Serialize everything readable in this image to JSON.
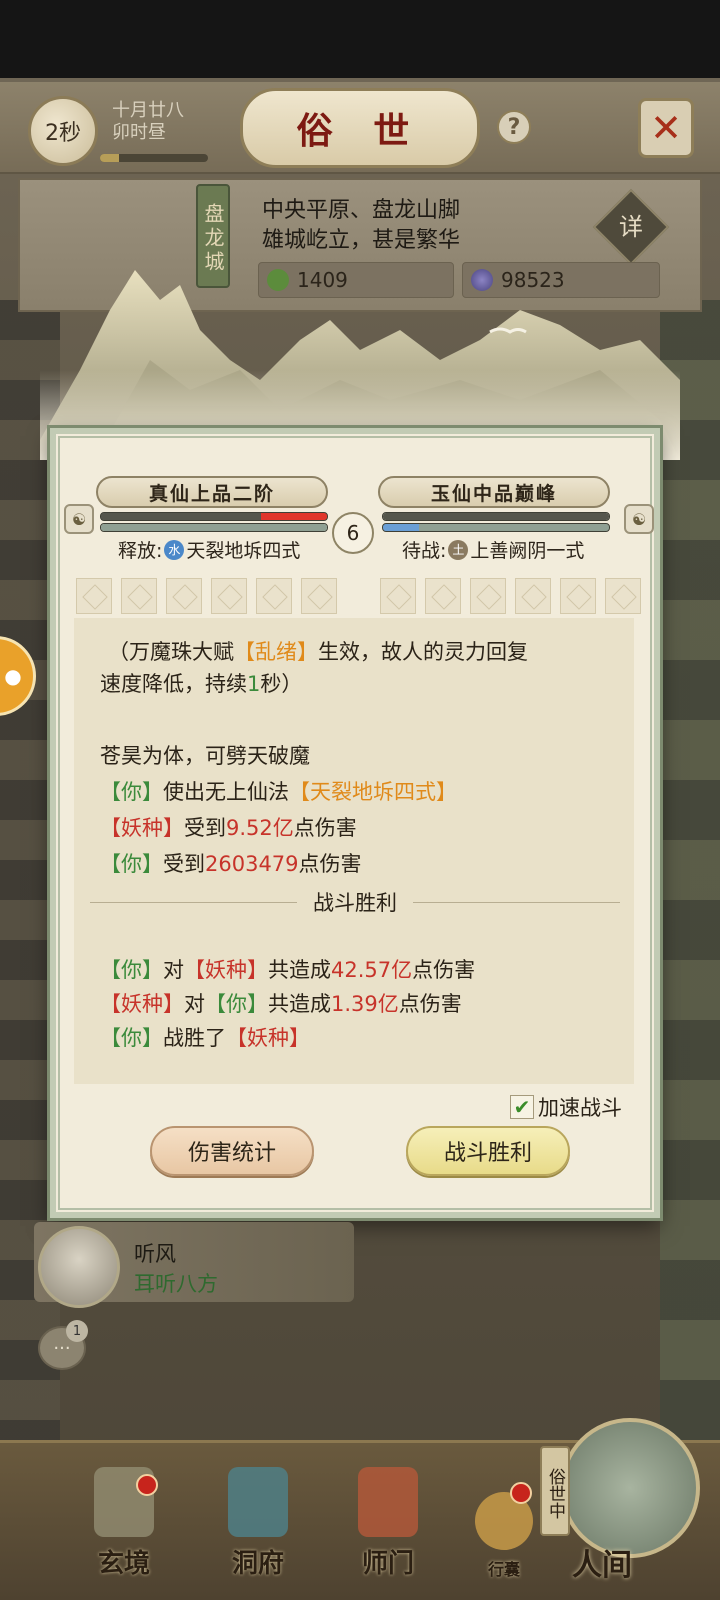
{
  "header": {
    "timer": "2秒",
    "date_line1": "十月廿八",
    "date_line2": "卯时昼",
    "time_progress": 0.18,
    "title": "俗 世",
    "help_glyph": "?",
    "close_glyph": "✕"
  },
  "city": {
    "name": "盘龙城",
    "desc_line1": "中央平原、盘龙山脚",
    "desc_line2": "雄城屹立，甚是繁华",
    "detail_label": "详",
    "resource1_icon": "leaf-icon",
    "resource1": "1409",
    "resource2_icon": "orb-icon",
    "resource2": "98523"
  },
  "battle": {
    "player_realm": "真仙上品二阶",
    "enemy_realm": "玉仙中品巅峰",
    "player_hp_fraction": 0.71,
    "player_hp_lost_fraction": 0.29,
    "player_mp_fraction": 1.0,
    "enemy_hp_fraction": 1.0,
    "enemy_mp_fraction": 0.16,
    "round": "6",
    "player_skill_prefix": "释放:",
    "player_skill_element": "水",
    "player_skill": "天裂地坼四式",
    "enemy_skill_prefix": "待战:",
    "enemy_skill_element": "土",
    "enemy_skill": "上善阙阴一式",
    "colors": {
      "hp_red": "#e0362b",
      "hp_dark": "#55564c",
      "mp_blue": "#6a9fd6",
      "mp_grey": "#8fa093",
      "elem_water": "#4b88c9",
      "elem_earth": "#8a7a60"
    }
  },
  "log": {
    "l1_a": "（万魔珠大赋",
    "l1_b": "【乱绪】",
    "l1_c": "生效，故人的灵力回复",
    "l2_a": "速度降低，持续",
    "l2_b": "1",
    "l2_c": "秒）",
    "l3": "苍昊为体，可劈天破魔",
    "l4_a": "【你】",
    "l4_b": "使出无上仙法",
    "l4_c": "【天裂地坼四式】",
    "l5_a": "【妖种】",
    "l5_b": "受到",
    "l5_c": "9.52亿",
    "l5_d": "点伤害",
    "l6_a": "【你】",
    "l6_b": "受到",
    "l6_c": "2603479",
    "l6_d": "点伤害",
    "divider": "战斗胜利",
    "s1_a": "【你】",
    "s1_b": "对",
    "s1_c": "【妖种】",
    "s1_d": "共造成",
    "s1_e": "42.57亿",
    "s1_f": "点伤害",
    "s2_a": "【妖种】",
    "s2_b": "对",
    "s2_c": "【你】",
    "s2_d": "共造成",
    "s2_e": "1.39亿",
    "s2_f": "点伤害",
    "s3_a": "【你】",
    "s3_b": "战胜了",
    "s3_c": "【妖种】"
  },
  "controls": {
    "speed_label": "加速战斗",
    "speed_checked": "✔",
    "stats_button": "伤害统计",
    "win_button": "战斗胜利"
  },
  "npc": {
    "name": "听风",
    "title": "耳听八方"
  },
  "chat": {
    "icon": "chat-icon",
    "badge": "1",
    "glyph": "···"
  },
  "left_float": {
    "icon": "gamepad-icon",
    "glyph": "●"
  },
  "nav": {
    "items": [
      {
        "label": "玄境"
      },
      {
        "label": "洞府"
      },
      {
        "label": "师门"
      },
      {
        "label": "行囊"
      }
    ],
    "world_tag": "俗世中",
    "world_label": "人间"
  }
}
